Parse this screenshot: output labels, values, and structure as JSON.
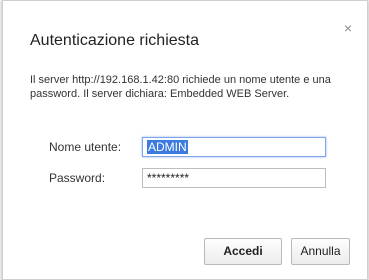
{
  "dialog": {
    "title": "Autenticazione richiesta",
    "close_symbol": "×",
    "message": "Il server http://192.168.1.42:80 richiede un nome utente e una password. Il server dichiara: Embedded WEB Server.",
    "username_label": "Nome utente:",
    "username_value": "ADMIN",
    "password_label": "Password:",
    "password_value": "*********",
    "primary_button": "Accedi",
    "secondary_button": "Annulla"
  },
  "icons": {
    "close": "close-icon"
  },
  "colors": {
    "selection": "#3b7be0",
    "focus_border": "#7ea6e8",
    "button_border": "#b8b8b8",
    "text": "#333333"
  }
}
